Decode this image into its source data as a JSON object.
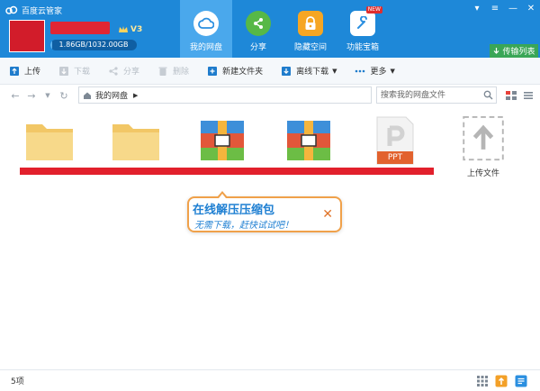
{
  "window": {
    "title": "百度云管家",
    "controls": {
      "skin": "▾",
      "menu": "≡",
      "minimize": "—",
      "close": "✕"
    }
  },
  "account": {
    "vip_label": "V3",
    "quota_text": "1.86GB/1032.00GB",
    "quota_used_fraction": 0.002
  },
  "nav": {
    "items": [
      {
        "label": "我的网盘",
        "icon": "cloud-icon",
        "active": true
      },
      {
        "label": "分享",
        "icon": "share-icon",
        "active": false
      },
      {
        "label": "隐藏空间",
        "icon": "lock-icon",
        "active": false
      },
      {
        "label": "功能宝箱",
        "icon": "toolbox-icon",
        "active": false,
        "badge": "NEW"
      }
    ],
    "transfer_label": "传输列表"
  },
  "toolbar": {
    "upload": "上传",
    "download": "下载",
    "share": "分享",
    "delete": "删除",
    "new_folder": "新建文件夹",
    "offline_download": "离线下载",
    "more": "更多"
  },
  "address": {
    "path": "我的网盘",
    "search_placeholder": "搜索我的网盘文件"
  },
  "files": {
    "items": [
      {
        "type": "folder",
        "name": ""
      },
      {
        "type": "folder",
        "name": ""
      },
      {
        "type": "archive",
        "name": ""
      },
      {
        "type": "archive",
        "name": ""
      },
      {
        "type": "ppt",
        "name": "",
        "ext_label": "PPT"
      },
      {
        "type": "upload",
        "name": "上传文件"
      }
    ]
  },
  "tooltip": {
    "title": "在线解压压缩包",
    "subtitle": "无需下载，赶快试试吧！",
    "close": "✕"
  },
  "status": {
    "count": "5项"
  },
  "colors": {
    "header": "#1e88d8",
    "accent_green": "#3aa657",
    "tooltip_border": "#f0a14a"
  }
}
